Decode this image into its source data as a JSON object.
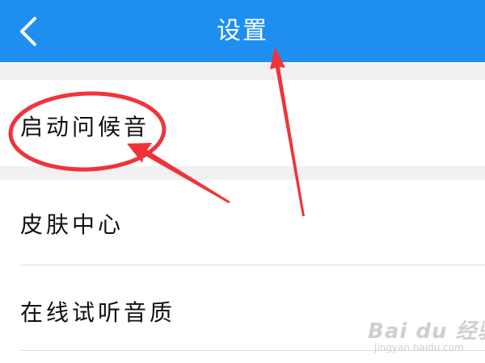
{
  "header": {
    "title": "设置",
    "back_icon": "chevron-left-icon"
  },
  "settings": {
    "items": [
      {
        "label": "启动问候音"
      },
      {
        "label": "皮肤中心"
      },
      {
        "label": "在线试听音质"
      }
    ]
  },
  "watermark": {
    "logo": "Bai du 经验",
    "sub": "jingyan.baidu.com"
  },
  "colors": {
    "header_bg": "#1e8ff0",
    "annotation": "#f0333a",
    "section_gap": "#f1f1f1"
  }
}
